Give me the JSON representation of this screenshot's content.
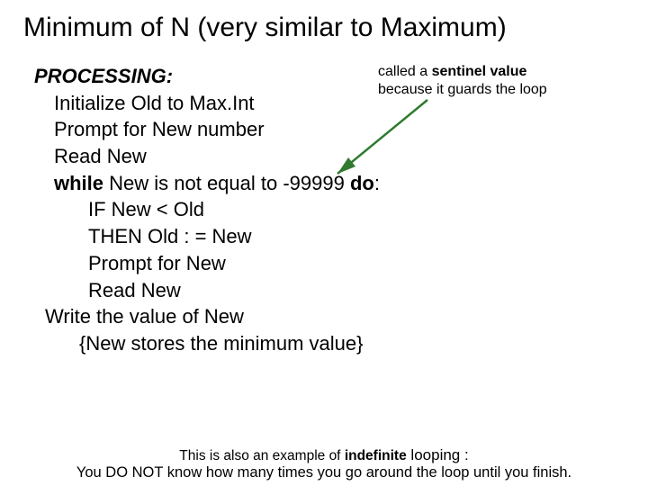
{
  "title": "Minimum of N (very similar to Maximum)",
  "heading": "PROCESSING:",
  "lines": {
    "l1": "Initialize Old to Max.Int",
    "l2a": "P",
    "l2b": "rompt for New number",
    "l3": "Read New",
    "l4a": "while",
    "l4b": " New is not equal to -99999 ",
    "l4c": "do",
    "l4d": ":",
    "l5": "IF New < Old",
    "l6": "THEN Old : = New",
    "l7": "Prompt for New",
    "l8": "Read New",
    "l9": "Write the value of New",
    "l10": "{New stores the minimum value}"
  },
  "callout": {
    "r1a": "called a ",
    "r1b": "sentinel value",
    "r2": "because it guards the loop"
  },
  "footer": {
    "f1a": "This is also an example of ",
    "f1b": "indefinite",
    "f1c": " looping :",
    "f2": "You DO NOT know how many times you go around the loop until you finish."
  }
}
